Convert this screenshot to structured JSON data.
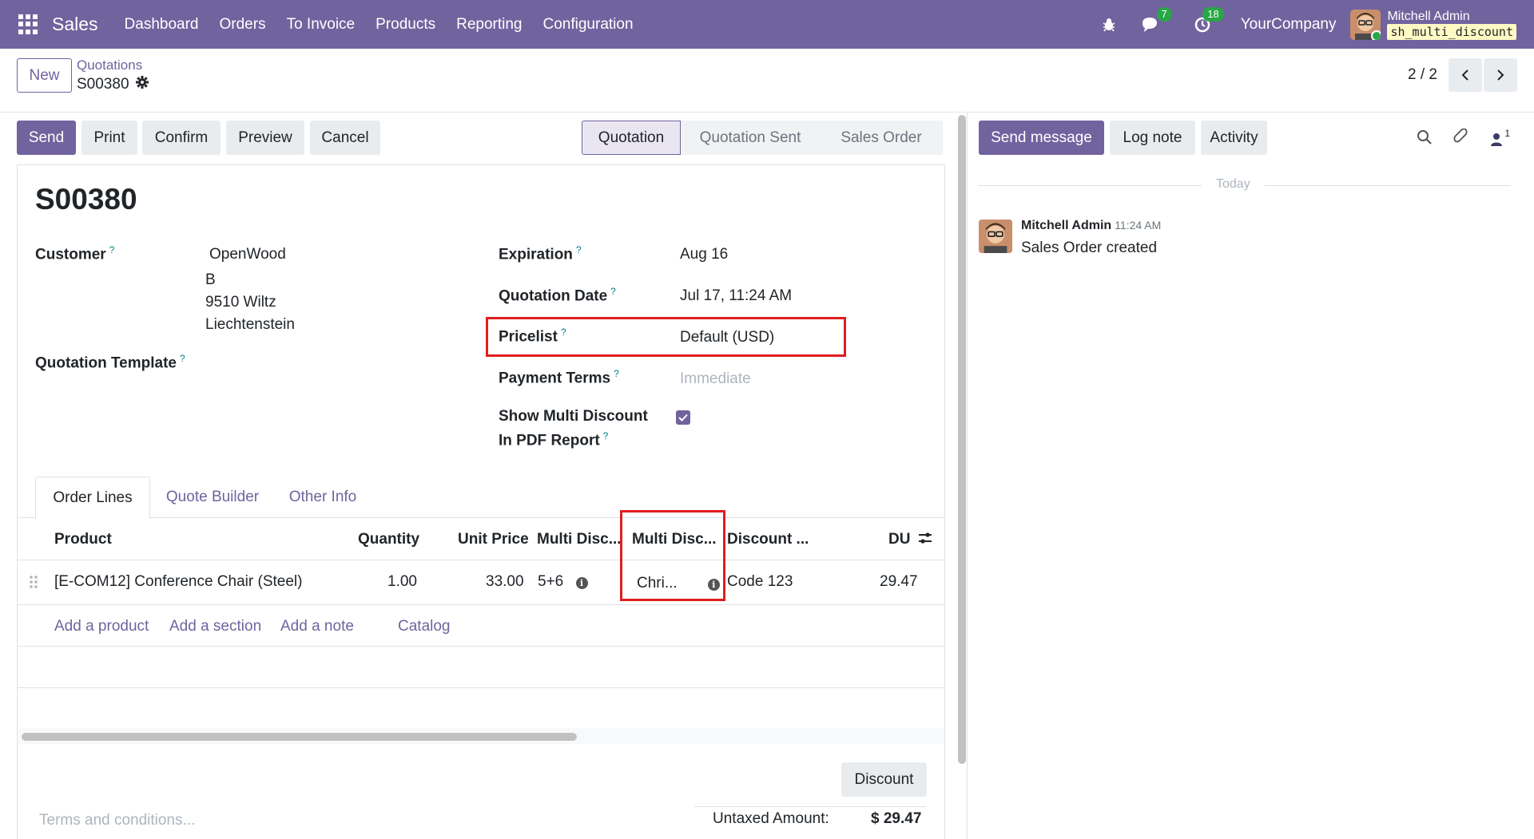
{
  "navbar": {
    "app_name": "Sales",
    "menu": [
      "Dashboard",
      "Orders",
      "To Invoice",
      "Products",
      "Reporting",
      "Configuration"
    ],
    "messages_count": "7",
    "activities_count": "18",
    "company": "YourCompany",
    "user_name": "Mitchell Admin",
    "db_name": "sh_multi_discount"
  },
  "control": {
    "new_label": "New",
    "breadcrumb_parent": "Quotations",
    "breadcrumb_current": "S00380",
    "pager": "2 / 2"
  },
  "actions": {
    "send": "Send",
    "print": "Print",
    "confirm": "Confirm",
    "preview": "Preview",
    "cancel": "Cancel"
  },
  "statusbar": {
    "stages": [
      "Quotation",
      "Quotation Sent",
      "Sales Order"
    ],
    "active": "Quotation"
  },
  "form": {
    "title": "S00380",
    "customer_label": "Customer",
    "customer_name": "OpenWood",
    "customer_address": [
      "B",
      "9510 Wiltz",
      "Liechtenstein"
    ],
    "quotation_template_label": "Quotation Template",
    "expiration_label": "Expiration",
    "expiration_value": "Aug 16",
    "quotation_date_label": "Quotation Date",
    "quotation_date_value": "Jul 17, 11:24 AM",
    "pricelist_label": "Pricelist",
    "pricelist_value": "Default (USD)",
    "payment_terms_label": "Payment Terms",
    "payment_terms_placeholder": "Immediate",
    "show_multi_discount_label_1": "Show Multi Discount",
    "show_multi_discount_label_2": "In PDF Report",
    "show_multi_discount_checked": true
  },
  "tabs": [
    "Order Lines",
    "Quote Builder",
    "Other Info"
  ],
  "order_lines": {
    "columns": [
      "Product",
      "Quantity",
      "Unit Price",
      "Multi Disc...",
      "Multi Disc...",
      "Discount ...",
      "DU"
    ],
    "rows": [
      {
        "product": "[E-COM12] Conference Chair (Steel)",
        "quantity": "1.00",
        "unit_price": "33.00",
        "multi_disc_1": "5+6",
        "multi_disc_2": "Chri...",
        "discount_code": "Code 123",
        "du": "29.47"
      }
    ],
    "add_links": [
      "Add a product",
      "Add a section",
      "Add a note",
      "Catalog"
    ]
  },
  "footer": {
    "discount_button": "Discount",
    "terms_placeholder": "Terms and conditions...",
    "untaxed_label": "Untaxed Amount:",
    "untaxed_value": "$ 29.47"
  },
  "chatter": {
    "send_message": "Send message",
    "log_note": "Log note",
    "activity": "Activity",
    "followers_count": "1",
    "today_label": "Today",
    "message_author": "Mitchell Admin",
    "message_time": "11:24 AM",
    "message_body": "Sales Order created"
  },
  "colors": {
    "brand": "#71639e",
    "highlight": "#e01e1e",
    "badge": "#28a745"
  }
}
